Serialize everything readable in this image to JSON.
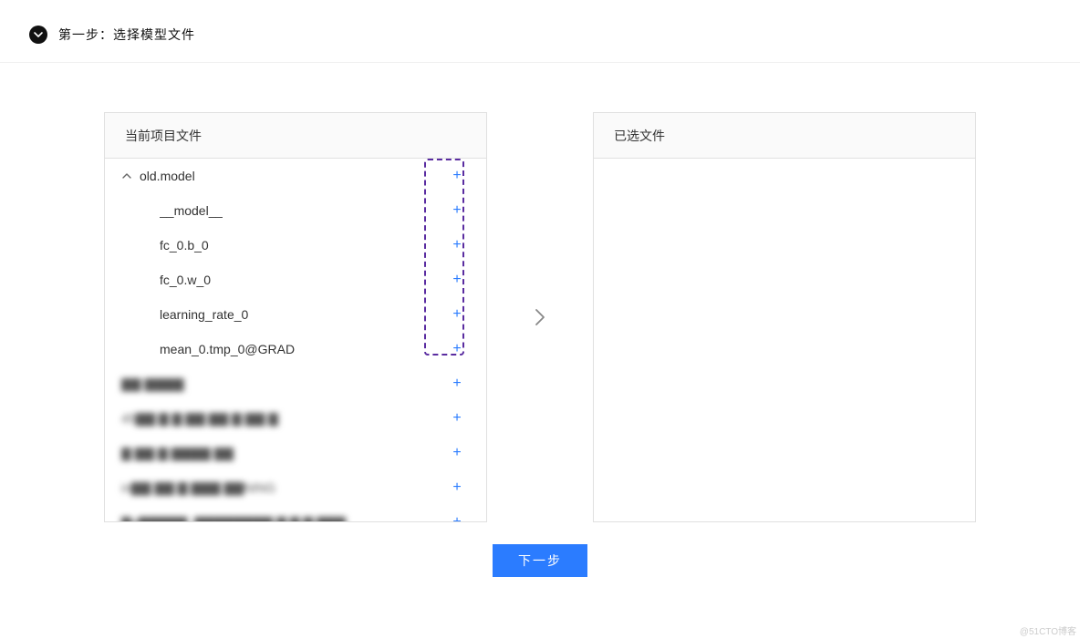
{
  "step": {
    "title": "第一步：选择模型文件"
  },
  "panels": {
    "left_title": "当前项目文件",
    "right_title": "已选文件"
  },
  "tree": {
    "root": "old.model",
    "children": [
      "__model__",
      "fc_0.b_0",
      "fc_0.w_0",
      "learning_rate_0",
      "mean_0.tmp_0@GRAD"
    ],
    "blurred_items": [
      "▇▇ ▇▇▇▇",
      "45▇▇ ▇ ▇ ▇▇ ▇▇ ▇ ▇▇ ▇",
      "▇ ▇▇ ▇ ▇▇▇▇ ▇▇",
      "in▇▇ ▇▇ ▇ ▇▇▇ ▇▇NING",
      "▇p▇▇▇▇▇_▇▇▇▇▇▇▇▇ ▇ ▇ ▇ ▇▇▇"
    ]
  },
  "buttons": {
    "next": "下一步",
    "add_symbol": "+"
  },
  "watermark": "@51CTO博客"
}
